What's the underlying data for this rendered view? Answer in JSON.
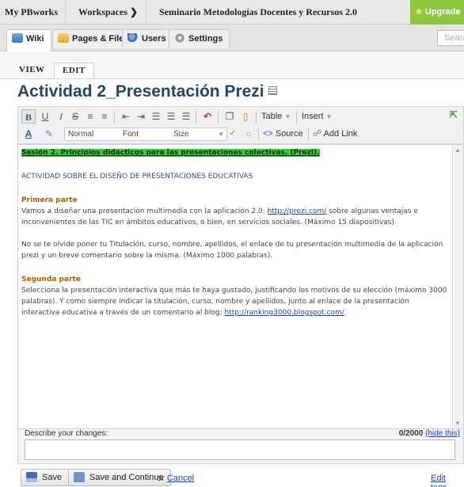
{
  "topbar": {
    "my_pbworks": "My PBworks",
    "workspaces": "Workspaces",
    "workspace_name": "Seminario Metodologías Docentes y Recursos 2.0",
    "upgrade": "Upgrade"
  },
  "nav": {
    "tabs": [
      {
        "label": "Wiki"
      },
      {
        "label": "Pages & Files"
      },
      {
        "label": "Users"
      },
      {
        "label": "Settings"
      }
    ],
    "search_placeholder": "Search"
  },
  "mode_tabs": {
    "view": "VIEW",
    "edit": "EDIT"
  },
  "page": {
    "title": "Actividad 2_Presentación Prezi"
  },
  "toolbar": {
    "bold": "B",
    "underline": "U",
    "italic": "I",
    "strike": "S",
    "table": "Table",
    "insert": "Insert",
    "style": "Normal",
    "font": "Font",
    "size": "Size",
    "source": "Source",
    "add_link": "Add Link"
  },
  "content": {
    "heading": "Sesión 2. Principios didácticos para las presentaciones colectivas. (Prezi).",
    "subtitle": "ACTIVIDAD SOBRE EL DISEÑO DE PRESENTACIONES EDUCATIVAS",
    "part1_title": "Primera parte",
    "part1_text_a": "Vamos a diseñar una presentación multimedia con la aplicación 2.0: ",
    "part1_link": "http://prezi.com/",
    "part1_text_b": " sobre algunas ventajas e inconvenientes de las TIC en ámbitos educativos, o bien, en servicios sociales. (Máximo 15 diapositivas).",
    "part1_text_c": "No se te olvide poner tu Titulación, curso, nombre, apellidos, el enlace de tu presentación multimedia de la aplicación prezi y un breve comentario sobre la misma. (Máximo 1000 palabras).",
    "part2_title": "Segunda parte",
    "part2_text_a": "Selecciona la presentación interactiva que más te haya gustado, justificando los motivos de su elección (máximo 3000 palabras). Y como siempre indicar la titulación, curso, nombre y apellidos, junto al enlace de la presentación interactiva educativa a través de un comentario al blog: ",
    "part2_link": "http://ranking3000.blogspot.com/"
  },
  "describe": {
    "label": "Describe your changes:",
    "counter": "0/2000",
    "hide": "(hide this)"
  },
  "actions": {
    "save": "Save",
    "save_continue": "Save and Continue",
    "or": "or",
    "cancel": "Cancel",
    "edit_tags": "Edit tags"
  },
  "colors": {
    "accent_green": "#8dc63f",
    "title_blue": "#24466b",
    "highlight": "#33d033",
    "heading_orange": "#b05a00"
  }
}
